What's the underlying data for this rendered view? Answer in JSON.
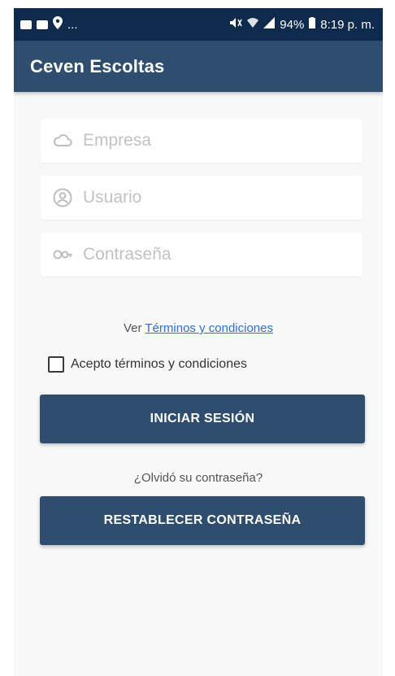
{
  "status_bar": {
    "dots": "...",
    "battery": "94%",
    "time": "8:19 p. m."
  },
  "app": {
    "title": "Ceven Escoltas"
  },
  "form": {
    "company_placeholder": "Empresa",
    "user_placeholder": "Usuario",
    "password_placeholder": "Contraseña"
  },
  "terms": {
    "prefix": "Ver ",
    "link": "Términos y condiciones"
  },
  "accept": {
    "label": "Acepto términos y condiciones",
    "checked": false
  },
  "buttons": {
    "login": "INICIAR SESIÓN",
    "forgot_text": "¿Olvidó su contraseña?",
    "reset": "RESTABLECER CONTRASEÑA"
  },
  "colors": {
    "status_bar": "#0e2a4d",
    "app_bar": "#2f4d6f",
    "primary_button": "#2f4d6f",
    "link": "#2d6fd1"
  },
  "icons": {
    "company": "cloud-icon",
    "user": "user-circle-icon",
    "password": "key-icon"
  }
}
